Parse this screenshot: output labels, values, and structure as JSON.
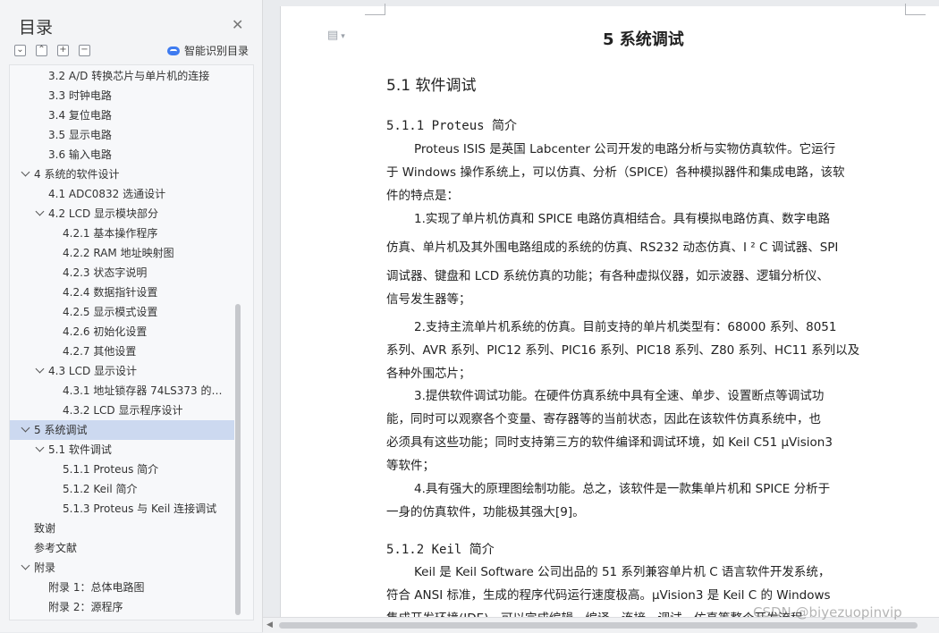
{
  "sidebar": {
    "title": "目录",
    "close_icon": "close-icon",
    "toolbar": {
      "collapse_all": "⌄",
      "expand_all": "⌃",
      "add": "+",
      "remove": "−",
      "smart_label": "智能识别目录"
    },
    "items": [
      {
        "label": "3.2 A/D 转换芯片与单片机的连接"
      },
      {
        "label": "3.3  时钟电路"
      },
      {
        "label": "3.4  复位电路"
      },
      {
        "label": "3.5  显示电路"
      },
      {
        "label": "3.6  输入电路"
      },
      {
        "label": "4 系统的软件设计"
      },
      {
        "label": "4.1 ADC0832 选通设计"
      },
      {
        "label": "4.2 LCD 显示模块部分"
      },
      {
        "label": "4.2.1 基本操作程序"
      },
      {
        "label": "4.2.2 RAM 地址映射图"
      },
      {
        "label": "4.2.3 状态字说明"
      },
      {
        "label": "4.2.4 数据指针设置"
      },
      {
        "label": "4.2.5 显示模式设置"
      },
      {
        "label": "4.2.6 初始化设置"
      },
      {
        "label": "4.2.7 其他设置"
      },
      {
        "label": "4.3 LCD 显示设计"
      },
      {
        "label": "4.3.1  地址锁存器 74LS373 的设…"
      },
      {
        "label": "4.3.2 LCD 显示程序设计"
      },
      {
        "label": "5 系统调试"
      },
      {
        "label": "5.1 软件调试"
      },
      {
        "label": "5.1.1 Proteus  简介"
      },
      {
        "label": "5.1.2 Keil  简介"
      },
      {
        "label": "5.1.3 Proteus 与 Keil 连接调试"
      },
      {
        "label": "致谢"
      },
      {
        "label": "参考文献"
      },
      {
        "label": "附录"
      },
      {
        "label": "附录 1：总体电路图"
      },
      {
        "label": "附录 2：源程序"
      }
    ]
  },
  "document": {
    "chapter_title": "5 系统调试",
    "section_title": "5.1 软件调试",
    "sub1_title": "5.1.1 Proteus 简介",
    "p1_l1": "Proteus ISIS 是英国 Labcenter 公司开发的电路分析与实物仿真软件。它运行",
    "p1_l2": "于 Windows 操作系统上，可以仿真、分析（SPICE）各种模拟器件和集成电路，该软",
    "p1_l3": "件的特点是：",
    "p2_l1": "1.实现了单片机仿真和 SPICE 电路仿真相结合。具有模拟电路仿真、数字电路",
    "p2_l2": "仿真、单片机及其外围电路组成的系统的仿真、RS232 动态仿真、I ² C 调试器、SPI",
    "p2_l3": "调试器、键盘和 LCD 系统仿真的功能；有各种虚拟仪器，如示波器、逻辑分析仪、",
    "p2_l4": "信号发生器等；",
    "p3_l1": "2.支持主流单片机系统的仿真。目前支持的单片机类型有：68000 系列、8051",
    "p3_l2": "系列、AVR 系列、PIC12 系列、PIC16 系列、PIC18 系列、Z80 系列、HC11 系列以及",
    "p3_l3": "各种外围芯片；",
    "p4_l1": "3.提供软件调试功能。在硬件仿真系统中具有全速、单步、设置断点等调试功",
    "p4_l2": "能，同时可以观察各个变量、寄存器等的当前状态，因此在该软件仿真系统中，也",
    "p4_l3": "必须具有这些功能；同时支持第三方的软件编译和调试环境，如 Keil C51 μVision3",
    "p4_l4": "等软件；",
    "p5_l1": "4.具有强大的原理图绘制功能。总之，该软件是一款集单片机和 SPICE 分析于",
    "p5_l2": "一身的仿真软件，功能极其强大[9]。",
    "sub2_title": "5.1.2 Keil 简介",
    "p6_l1": "Keil 是 Keil Software 公司出品的 51 系列兼容单片机 C 语言软件开发系统，",
    "p6_l2": "符合 ANSI 标准，生成的程序代码运行速度极高。μVision3 是 Keil C 的 Windows",
    "p6_l3": "集成开发环境(IDE)，可以完成编辑、编译、连接、调试、仿真等整个开发流程。"
  },
  "watermark": "CSDN @biyezuopinvip",
  "colors": {
    "selected_bg": "#ccd9f0",
    "accent": "#3e7bf0"
  }
}
